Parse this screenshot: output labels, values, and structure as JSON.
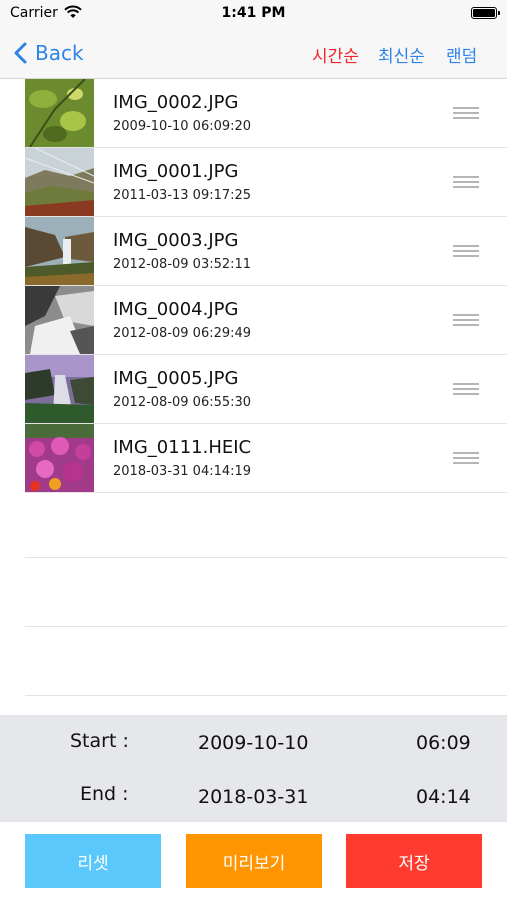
{
  "status_bar": {
    "carrier": "Carrier",
    "time": "1:41 PM"
  },
  "nav": {
    "back_label": "Back",
    "sort_options": [
      {
        "label": "시간순",
        "active": true
      },
      {
        "label": "최신순",
        "active": false
      },
      {
        "label": "랜덤",
        "active": false
      }
    ]
  },
  "photos": [
    {
      "name": "IMG_0002.JPG",
      "date": "2009-10-10 06:09:20",
      "thumbnail": "green-leaves-photo"
    },
    {
      "name": "IMG_0001.JPG",
      "date": "2011-03-13 09:17:25",
      "thumbnail": "hillside-landscape-photo"
    },
    {
      "name": "IMG_0003.JPG",
      "date": "2012-08-09 03:52:11",
      "thumbnail": "waterfall-cliff-photo"
    },
    {
      "name": "IMG_0004.JPG",
      "date": "2012-08-09 06:29:49",
      "thumbnail": "black-white-rocks-photo"
    },
    {
      "name": "IMG_0005.JPG",
      "date": "2012-08-09 06:55:30",
      "thumbnail": "misty-waterfall-photo"
    },
    {
      "name": "IMG_0111.HEIC",
      "date": "2018-03-31 04:14:19",
      "thumbnail": "pink-flowers-photo"
    }
  ],
  "range": {
    "start_label": "Start :",
    "start_date": "2009-10-10",
    "start_time": "06:09",
    "end_label": "End :",
    "end_date": "2018-03-31",
    "end_time": "04:14"
  },
  "actions": {
    "reset_label": "리셋",
    "preview_label": "미리보기",
    "save_label": "저장"
  },
  "colors": {
    "accent_blue": "#2d84e8",
    "active_red": "#f0262c",
    "reset_button": "#5ac8fa",
    "preview_button": "#ff9500",
    "save_button": "#ff3b30"
  }
}
